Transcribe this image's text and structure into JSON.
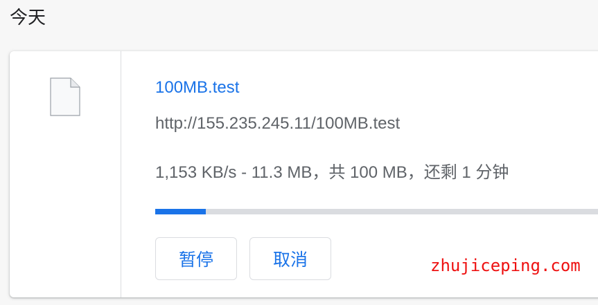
{
  "section": {
    "date_label": "今天"
  },
  "download": {
    "file_name": "100MB.test",
    "url": "http://155.235.245.11/100MB.test",
    "status": "1,153 KB/s - 11.3 MB，共 100 MB，还剩 1 分钟",
    "progress_fraction": 0.113,
    "icon": "file-icon"
  },
  "actions": {
    "pause_label": "暂停",
    "cancel_label": "取消"
  },
  "watermark": {
    "text": "zhujiceping.com"
  },
  "colors": {
    "accent": "#1a73e8",
    "watermark": "#ee1111",
    "track": "#dadce0"
  }
}
